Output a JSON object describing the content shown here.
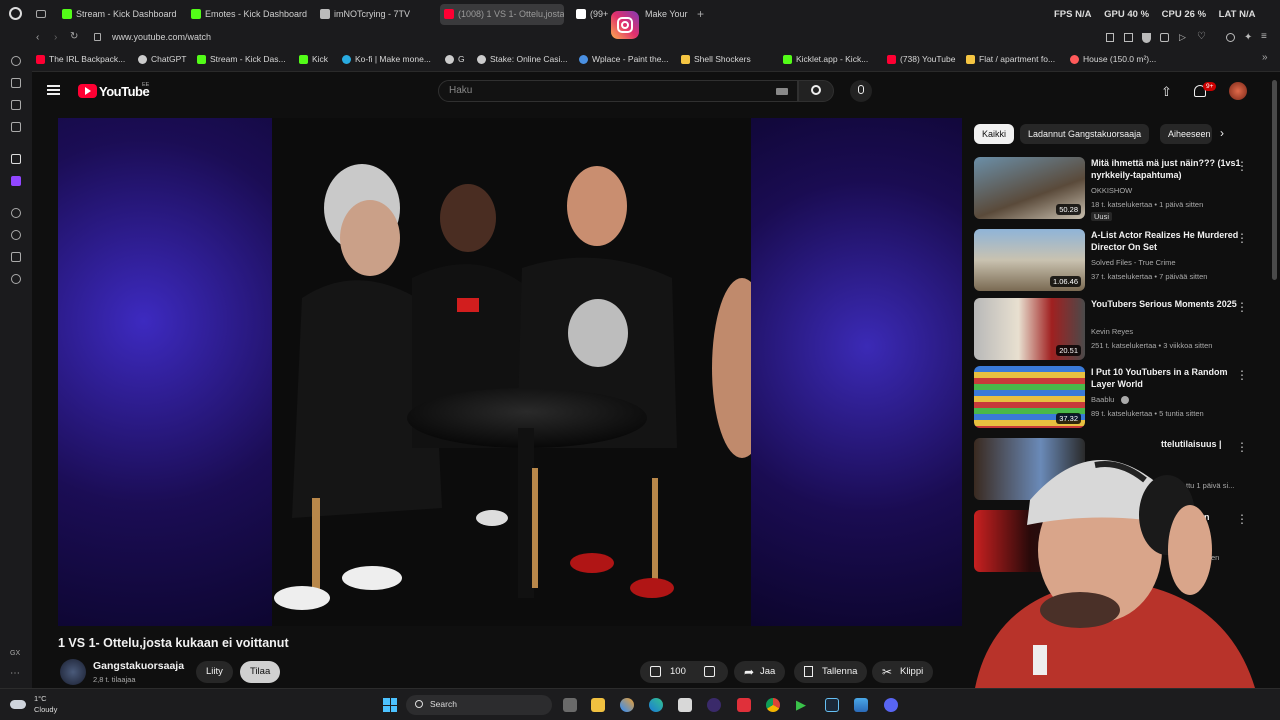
{
  "browser": {
    "tabs": [
      {
        "label": "Stream - Kick Dashboard",
        "color": "#53fc18"
      },
      {
        "label": "Emotes - Kick Dashboard",
        "color": "#53fc18"
      },
      {
        "label": "imNOTcrying - 7TV",
        "color": "#bbbbbb"
      },
      {
        "label": "(1008) 1 VS 1- Ottelu,josta",
        "color": "#ff0033"
      },
      {
        "label": "(99+",
        "color": "#ffffff"
      },
      {
        "label": "Make Your",
        "color": "#aaaaaa"
      }
    ],
    "url": "www.youtube.com/watch",
    "perf": {
      "fps_label": "FPS",
      "fps_value": "N/A",
      "gpu_label": "GPU",
      "gpu_value": "40 %",
      "cpu_label": "CPU",
      "cpu_value": "26 %",
      "lat_label": "LAT",
      "lat_value": "N/A"
    },
    "bookmarks": [
      {
        "label": "The IRL Backpack...",
        "color": "#ff0033"
      },
      {
        "label": "ChatGPT",
        "color": "#cccccc"
      },
      {
        "label": "Stream - Kick Das...",
        "color": "#53fc18"
      },
      {
        "label": "Kick",
        "color": "#53fc18"
      },
      {
        "label": "Ko-fi | Make mone...",
        "color": "#29abe0"
      },
      {
        "label": "G",
        "color": "#cccccc"
      },
      {
        "label": "Stake: Online Casi...",
        "color": "#cccccc"
      },
      {
        "label": "Wplace - Paint the...",
        "color": "#4a90e2"
      },
      {
        "label": "Shell Shockers",
        "color": "#f5c542"
      },
      {
        "label": "Kicklet.app - Kick...",
        "color": "#53fc18"
      },
      {
        "label": "(738) YouTube",
        "color": "#ff0033"
      },
      {
        "label": "Flat / apartment fo...",
        "color": "#f5c542"
      },
      {
        "label": "House (150.0 m²)...",
        "color": "#ff5a5a"
      }
    ]
  },
  "youtube": {
    "logo_text": "YouTube",
    "region": "EE",
    "search_placeholder": "Haku",
    "notif_count": "9+",
    "video_title": "1 VS 1- Ottelu,josta kukaan ei voittanut",
    "channel_name": "Gangstakuorsaaja",
    "subscribers": "2,8 t. tilaajaa",
    "join_label": "Liity",
    "subscribe_label": "Tilaa",
    "like_count": "100",
    "share_label": "Jaa",
    "save_label": "Tallenna",
    "clip_label": "Klippi",
    "chips": [
      "Kaikki",
      "Ladannut Gangstakuorsaaja",
      "Aiheeseen"
    ],
    "recommendations": [
      {
        "title": "Mitä ihmettä mä just näin??? (1vs1 nyrkkeily-tapahtuma)",
        "channel": "OKKISHOW",
        "meta": "18 t. katselukertaa • 1 päivä sitten",
        "badge": "Uusi",
        "duration": "50.28"
      },
      {
        "title": "A-List Actor Realizes He Murdered Director On Set",
        "channel": "Solved Files - True Crime",
        "meta": "37 t. katselukertaa • 7 päivää sitten",
        "badge": "",
        "duration": "1.06.46"
      },
      {
        "title": "YouTubers Serious Moments 2025",
        "channel": "Kevin Reyes",
        "meta": "251 t. katselukertaa • 3 viikkoa sitten",
        "badge": "",
        "duration": "20.51"
      },
      {
        "title": "I Put 10 YouTubers in a Random Layer World",
        "channel": "Baablu",
        "meta": "89 t. katselukertaa • 5 tuntia sitten",
        "badge": "",
        "duration": "37.32"
      },
      {
        "title": "ttelutilaisuus |",
        "channel": "",
        "meta": "ttu 1 päivä si...",
        "badge": "",
        "duration": ""
      },
      {
        "title": "en",
        "channel": "",
        "meta": "en",
        "badge": "",
        "duration": ""
      }
    ]
  },
  "taskbar": {
    "weather_temp": "1°C",
    "weather_desc": "Cloudy",
    "search_label": "Search",
    "gx_label": "GX"
  }
}
